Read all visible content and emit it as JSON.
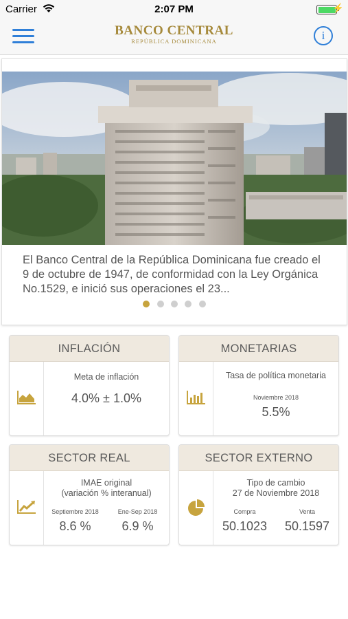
{
  "status_bar": {
    "carrier": "Carrier",
    "time": "2:07 PM"
  },
  "nav": {
    "brand_title": "BANCO CENTRAL",
    "brand_subtitle": "REPÚBLICA DOMINICANA",
    "info_label": "i"
  },
  "carousel": {
    "text": "El Banco Central de la República Dominicana fue creado el 9 de octubre de 1947, de conformidad con la Ley Orgánica No.1529, e inició sus operaciones el 23...",
    "page_count": 5,
    "active_page": 1
  },
  "cards": {
    "inflacion": {
      "title": "INFLACIÓN",
      "label": "Meta de inflación",
      "value": "4.0% ± 1.0%",
      "icon": "area-chart-icon"
    },
    "monetarias": {
      "title": "MONETARIAS",
      "label": "Tasa de política monetaria",
      "period": "Noviembre 2018",
      "value": "5.5%",
      "icon": "bar-chart-icon"
    },
    "sector_real": {
      "title": "SECTOR REAL",
      "label_line1": "IMAE original",
      "label_line2": "(variación % interanual)",
      "col1_period": "Septiembre 2018",
      "col1_value": "8.6 %",
      "col2_period": "Ene-Sep 2018",
      "col2_value": "6.9 %",
      "icon": "line-chart-icon"
    },
    "sector_externo": {
      "title": "SECTOR EXTERNO",
      "label_line1": "Tipo de cambio",
      "label_line2": "27 de Noviembre 2018",
      "col1_period": "Compra",
      "col1_value": "50.1023",
      "col2_period": "Venta",
      "col2_value": "50.1597",
      "icon": "pie-chart-icon"
    }
  },
  "colors": {
    "accent_gold": "#c7a43e",
    "nav_blue": "#2f7fd8",
    "card_header_bg": "#efe9df"
  }
}
